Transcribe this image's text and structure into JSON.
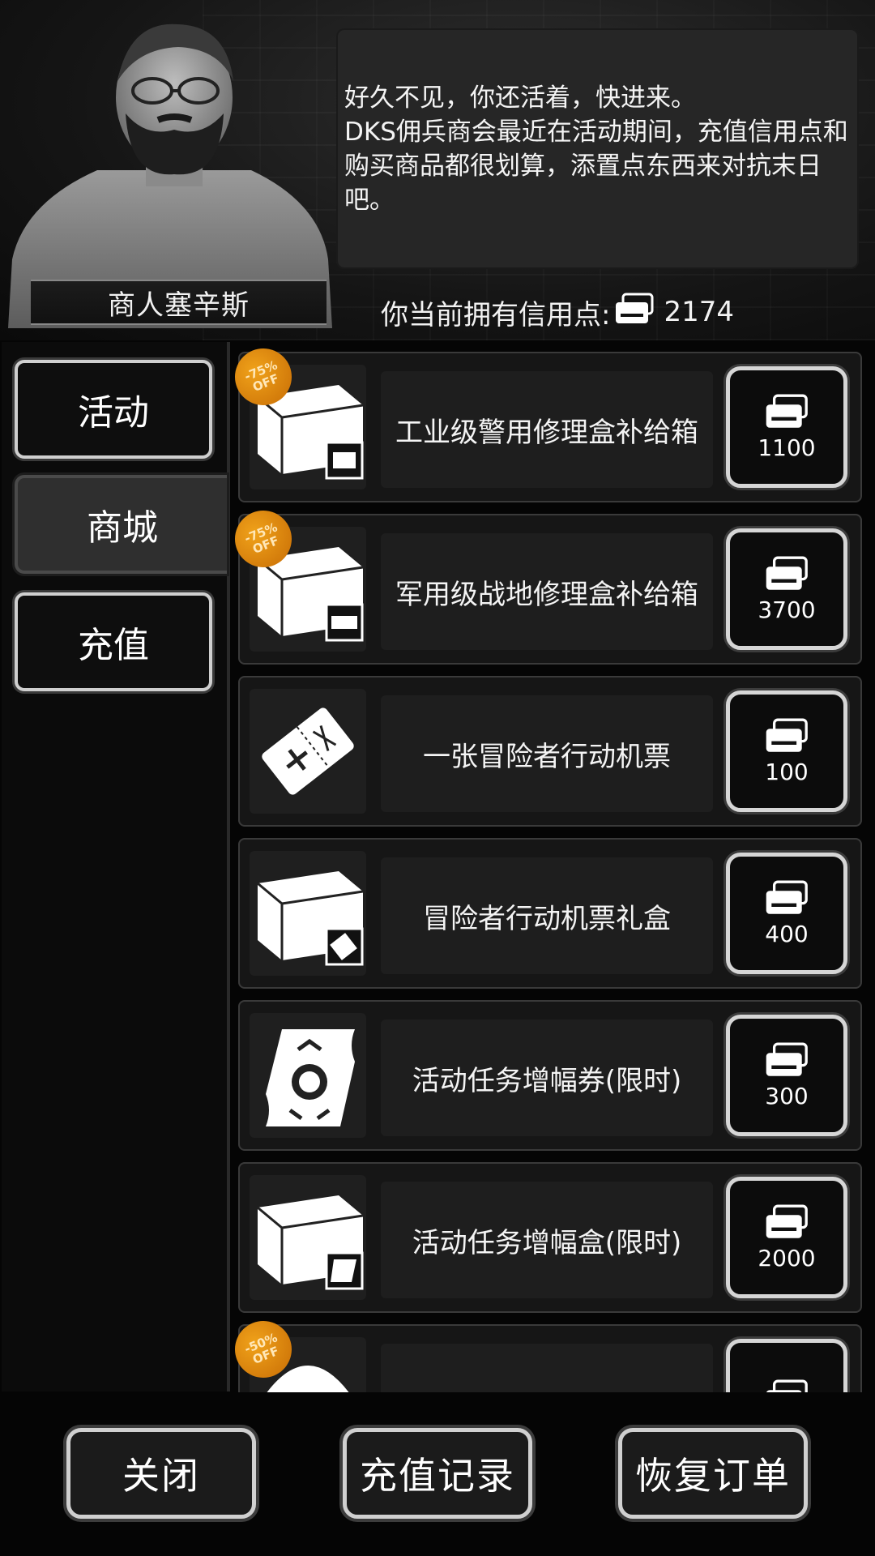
{
  "npc": {
    "name": "商人塞辛斯",
    "speech": "好久不见，你还活着，快进来。\nDKS佣兵商会最近在活动期间，充值信用点和购买商品都很划算，添置点东西来对抗末日吧。"
  },
  "credits": {
    "label": "你当前拥有信用点:",
    "icon": "credit-card-icon",
    "value": "2174"
  },
  "nav": {
    "items": [
      {
        "label": "活动",
        "active": false
      },
      {
        "label": "商城",
        "active": true
      },
      {
        "label": "充值",
        "active": false
      }
    ]
  },
  "shop": {
    "items": [
      {
        "name": "工业级警用修理盒补给箱",
        "price": "1100",
        "discount": "-75% OFF",
        "icon": "supply-crate-icon"
      },
      {
        "name": "军用级战地修理盒补给箱",
        "price": "3700",
        "discount": "-75% OFF",
        "icon": "supply-crate-icon"
      },
      {
        "name": "一张冒险者行动机票",
        "price": "100",
        "discount": "",
        "icon": "ticket-icon"
      },
      {
        "name": "冒险者行动机票礼盒",
        "price": "400",
        "discount": "",
        "icon": "supply-crate-icon"
      },
      {
        "name": "活动任务增幅券(限时)",
        "price": "300",
        "discount": "",
        "icon": "scroll-icon"
      },
      {
        "name": "活动任务增幅盒(限时)",
        "price": "2000",
        "discount": "",
        "icon": "supply-crate-icon"
      },
      {
        "name": "",
        "price": "",
        "discount": "-50% OFF",
        "icon": "parachute-icon"
      }
    ]
  },
  "footer": {
    "close": "关闭",
    "recharge_history": "充值记录",
    "restore_orders": "恢复订单"
  },
  "colors": {
    "discount_badge": "#e08a10",
    "button_border": "#d6d6d6",
    "panel_bg": "#161616"
  }
}
